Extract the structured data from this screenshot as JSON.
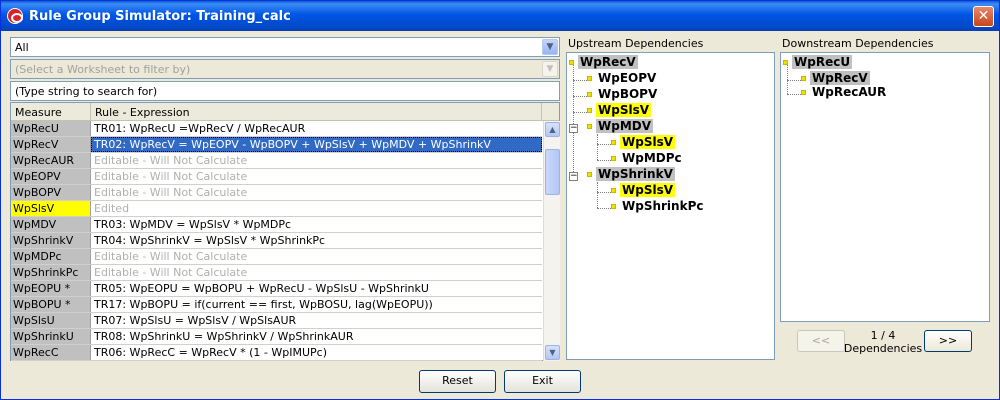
{
  "window": {
    "title": "Rule Group Simulator: Training_calc",
    "close_label": "✕"
  },
  "filters": {
    "group_selected": "All",
    "worksheet_placeholder": "(Select a Worksheet to filter by)",
    "search_placeholder": "(Type string to search for)"
  },
  "grid": {
    "columns": [
      "Measure",
      "Rule - Expression"
    ],
    "rows": [
      {
        "measure": "WpRecU",
        "rule": "TR01:  WpRecU =WpRecV / WpRecAUR"
      },
      {
        "measure": "WpRecV",
        "rule": "TR02:  WpRecV = WpEOPV - WpBOPV + WpSlsV + WpMDV + WpShrinkV"
      },
      {
        "measure": "WpRecAUR",
        "rule": "Editable - Will Not Calculate"
      },
      {
        "measure": "WpEOPV",
        "rule": "Editable - Will Not Calculate"
      },
      {
        "measure": "WpBOPV",
        "rule": "Editable - Will Not Calculate"
      },
      {
        "measure": "WpSlsV",
        "rule": "Edited"
      },
      {
        "measure": "WpMDV",
        "rule": "TR03:  WpMDV = WpSlsV * WpMDPc"
      },
      {
        "measure": "WpShrinkV",
        "rule": "TR04:  WpShrinkV = WpSlsV * WpShrinkPc"
      },
      {
        "measure": "WpMDPc",
        "rule": "Editable - Will Not Calculate"
      },
      {
        "measure": "WpShrinkPc",
        "rule": "Editable - Will Not Calculate"
      },
      {
        "measure": "WpEOPU *",
        "rule": "TR05:  WpEOPU = WpBOPU + WpRecU - WpSlsU - WpShrinkU"
      },
      {
        "measure": "WpBOPU *",
        "rule": "TR17:  WpBOPU = if(current == first, WpBOSU, lag(WpEOPU))"
      },
      {
        "measure": "WpSlsU",
        "rule": "TR07:  WpSlsU = WpSlsV / WpSlsAUR"
      },
      {
        "measure": "WpShrinkU",
        "rule": "TR08:  WpShrinkU = WpShrinkV / WpShrinkAUR"
      },
      {
        "measure": "WpRecC",
        "rule": "TR06:  WpRecC = WpRecV * (1 - WpIMUPc)"
      }
    ]
  },
  "upstream": {
    "title": "Upstream Dependencies",
    "nodes": [
      "WpRecV",
      "WpEOPV",
      "WpBOPV",
      "WpSlsV",
      "WpMDV",
      "WpSlsV",
      "WpMDPc",
      "WpShrinkV",
      "WpSlsV",
      "WpShrinkPc"
    ]
  },
  "downstream": {
    "title": "Downstream Dependencies",
    "nodes": [
      "WpRecU",
      "WpRecV",
      "WpRecAUR"
    ],
    "prev_label": "<<",
    "next_label": ">>",
    "page_text": "1 / 4",
    "page_caption": "Dependencies"
  },
  "buttons": {
    "reset": "Reset",
    "exit": "Exit"
  }
}
